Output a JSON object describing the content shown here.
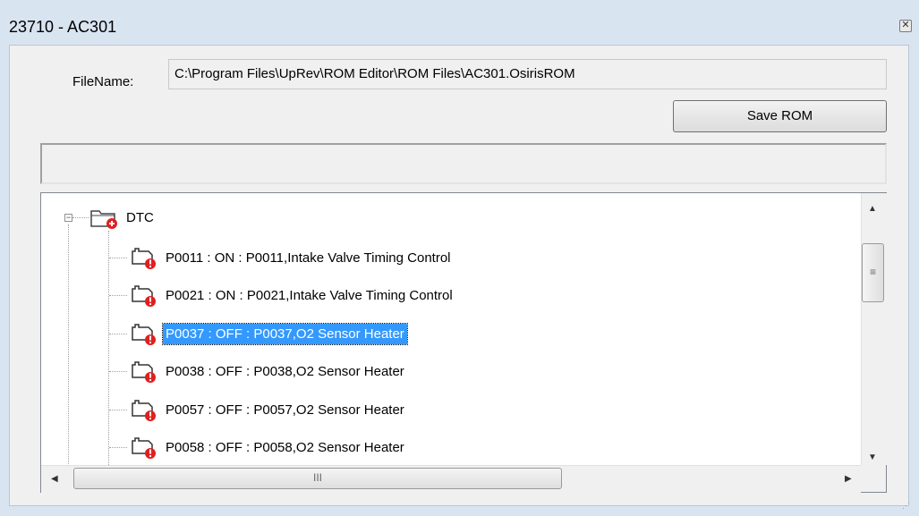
{
  "window": {
    "title": "23710 - AC301",
    "close_glyph": "✕"
  },
  "filename": {
    "label": "FileName:",
    "value": "C:\\Program Files\\UpRev\\ROM Editor\\ROM Files\\AC301.OsirisROM"
  },
  "toolbar": {
    "save_label": "Save ROM"
  },
  "tree": {
    "root": {
      "label": "DTC",
      "icon": "folder-icon",
      "expanded": true
    },
    "items": [
      {
        "label": "P0011 : ON  : P0011,Intake Valve Timing Control",
        "icon": "engine-warning-icon",
        "selected": false
      },
      {
        "label": "P0021 : ON  : P0021,Intake Valve Timing Control",
        "icon": "engine-warning-icon",
        "selected": false
      },
      {
        "label": "P0037 : OFF : P0037,O2 Sensor Heater",
        "icon": "engine-warning-icon",
        "selected": true
      },
      {
        "label": "P0038 : OFF : P0038,O2 Sensor Heater",
        "icon": "engine-warning-icon",
        "selected": false
      },
      {
        "label": "P0057 : OFF : P0057,O2 Sensor Heater",
        "icon": "engine-warning-icon",
        "selected": false
      },
      {
        "label": "P0058 : OFF : P0058,O2 Sensor Heater",
        "icon": "engine-warning-icon",
        "selected": false
      }
    ]
  },
  "scrollbar": {
    "grip_glyph": "≡",
    "hgrip_glyph": "III",
    "up": "▲",
    "down": "▼",
    "left": "◀",
    "right": "▶"
  },
  "colors": {
    "selection": "#3399ff",
    "warning": "#e02020",
    "frame": "#d9e4f1"
  }
}
